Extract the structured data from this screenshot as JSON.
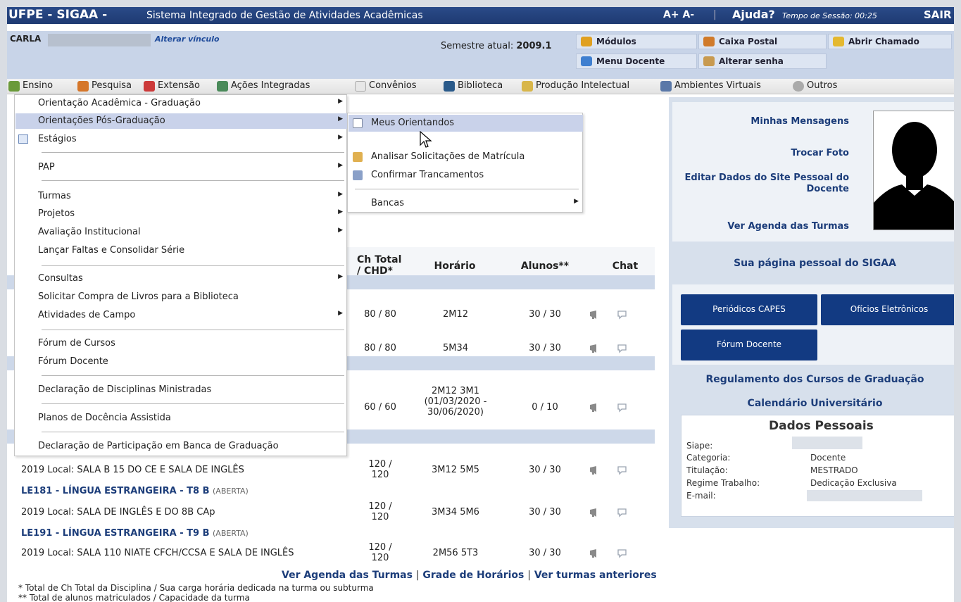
{
  "header": {
    "app": "UFPE - SIGAA -",
    "system": "Sistema Integrado de Gestão de Atividades Acadêmicas",
    "font_controls": "A+ A-",
    "separator": "|",
    "help": "Ajuda?",
    "session": "Tempo de Sessão: 00:25",
    "logout": "SAIR"
  },
  "user": {
    "name": "CARLA",
    "change_link": "Alterar vínculo",
    "semester_label": "Semestre atual:",
    "semester_value": "2009.1"
  },
  "toolbar": {
    "modulos": "Módulos",
    "caixa_postal": "Caixa Postal",
    "abrir_chamado": "Abrir Chamado",
    "menu_docente": "Menu Docente",
    "alterar_senha": "Alterar senha"
  },
  "menubar": [
    "Ensino",
    "Pesquisa",
    "Extensão",
    "Ações Integradas",
    "Convênios",
    "Biblioteca",
    "Produção Intelectual",
    "Ambientes Virtuais",
    "Outros"
  ],
  "dropdown": [
    "Orientação Acadêmica - Graduação",
    "Orientações Pós-Graduação",
    "Estágios",
    "PAP",
    "Turmas",
    "Projetos",
    "Avaliação Institucional",
    "Lançar Faltas e Consolidar Série",
    "Consultas",
    "Solicitar Compra de Livros para a Biblioteca",
    "Atividades de Campo",
    "Fórum de Cursos",
    "Fórum Docente",
    "Declaração de Disciplinas Ministradas",
    "Planos de Docência Assistida",
    "Declaração de Participação em Banca de Graduação"
  ],
  "submenu": [
    "Meus Orientandos",
    "Analisar Solicitações de Matrícula",
    "Confirmar Trancamentos",
    "Bancas"
  ],
  "table": {
    "headers": {
      "ch": "Ch Total / CHD*",
      "horario": "Horário",
      "alunos": "Alunos**",
      "chat": "Chat"
    },
    "rows": [
      {
        "ch": "80 / 80",
        "horario": "2M12",
        "alunos": "30 / 30"
      },
      {
        "ch": "80 / 80",
        "horario": "5M34",
        "alunos": "30 / 30"
      },
      {
        "ch": "60 / 60",
        "horario": "2M12 3M1 (01/03/2020 - 30/06/2020)",
        "alunos": "0 / 10"
      },
      {
        "local": "2019 Local: SALA B 15 DO CE E SALA DE INGLÊS",
        "ch": "120 / 120",
        "horario": "3M12 5M5",
        "alunos": "30 / 30"
      },
      {
        "turma": "LE181 - LÍNGUA ESTRANGEIRA - T8 B",
        "status": "(ABERTA)",
        "local": "2019 Local: SALA DE INGLÊS E DO 8B CAp",
        "ch": "120 / 120",
        "horario": "3M34 5M6",
        "alunos": "30 / 30"
      },
      {
        "turma": "LE191 - LÍNGUA ESTRANGEIRA - T9 B",
        "status": "(ABERTA)",
        "local": "2019 Local: SALA 110 NIATE CFCH/CCSA E SALA DE INGLÊS",
        "ch": "120 / 120",
        "horario": "2M56 5T3",
        "alunos": "30 / 30"
      }
    ]
  },
  "links": {
    "agenda": "Ver Agenda das Turmas",
    "grade": "Grade de Horários",
    "anteriores": "Ver turmas anteriores",
    "sep": "|"
  },
  "footnotes": [
    "* Total de Ch Total da Disciplina / Sua carga horária dedicada na turma ou subturma",
    "** Total de alunos matriculados / Capacidade da turma"
  ],
  "sidebar": {
    "mensagens": "Minhas Mensagens",
    "trocar_foto": "Trocar Foto",
    "editar_site": "Editar Dados do Site Pessoal do Docente",
    "ver_agenda": "Ver Agenda das Turmas",
    "pagina_pessoal": "Sua página pessoal do SIGAA",
    "periodicos": "Periódicos CAPES",
    "oficios": "Ofícios Eletrônicos",
    "forum": "Fórum Docente",
    "regulamento": "Regulamento dos Cursos de Graduação",
    "calendario": "Calendário Universitário",
    "dados_title": "Dados Pessoais",
    "fields": [
      {
        "label": "Siape:",
        "value": ""
      },
      {
        "label": "Categoria:",
        "value": "Docente"
      },
      {
        "label": "Titulação:",
        "value": "MESTRADO"
      },
      {
        "label": "Regime Trabalho:",
        "value": "Dedicação Exclusiva"
      },
      {
        "label": "E-mail:",
        "value": ""
      }
    ]
  },
  "colors": {
    "topbar": "#1e3a72",
    "link": "#1c3d7a",
    "button": "#123a82",
    "highlight": "#c9d2ea",
    "stripe": "#cdd8e9"
  }
}
